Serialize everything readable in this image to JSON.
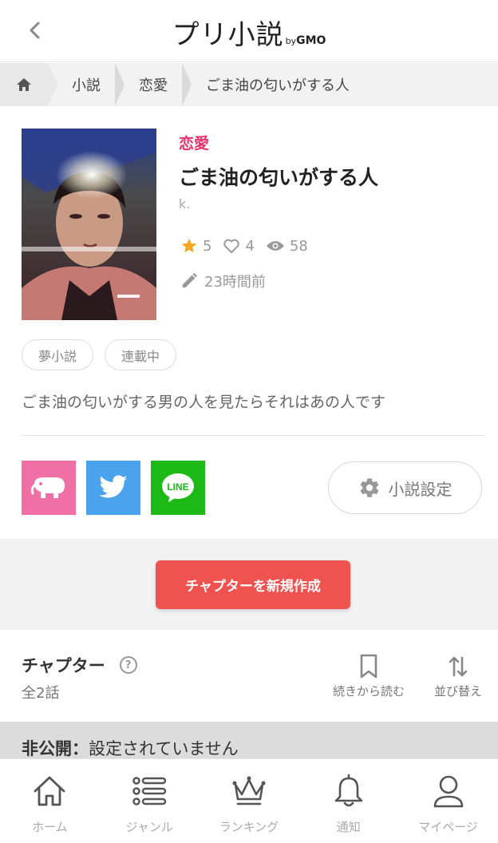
{
  "header": {
    "back_icon": "chevron-left-icon",
    "logo_text": "プリ小説",
    "logo_by": "by",
    "logo_gmo": "GMO"
  },
  "breadcrumb": {
    "home_icon": "home-icon",
    "items": [
      "小説",
      "恋愛",
      "ごま油の匂いがする人"
    ]
  },
  "novel": {
    "genre": "恋愛",
    "title": "ごま油の匂いがする人",
    "author": "k.",
    "stars": "5",
    "likes": "4",
    "views": "58",
    "updated": "23時間前",
    "tags": [
      "夢小説",
      "連載中"
    ],
    "summary": "ごま油の匂いがする男の人を見たらそれはあの人です"
  },
  "share": {
    "line_label": "LINE"
  },
  "settings_button": "小説設定",
  "create_chapter_button": "チャプターを新規作成",
  "chapters": {
    "heading": "チャプター",
    "help": "?",
    "count": "全2話",
    "resume_label": "続きから読む",
    "sort_label": "並び替え"
  },
  "private": {
    "label": "非公開：",
    "value": "設定されていません"
  },
  "bottom_nav": {
    "home": "ホーム",
    "genre": "ジャンル",
    "ranking": "ランキング",
    "notify": "通知",
    "mypage": "マイページ"
  },
  "colors": {
    "accent_pink": "#e8336d",
    "create_red": "#ef5350",
    "star": "#f5a623",
    "twitter": "#4aa3ec",
    "line": "#1db917",
    "prichat": "#f06fa5"
  }
}
